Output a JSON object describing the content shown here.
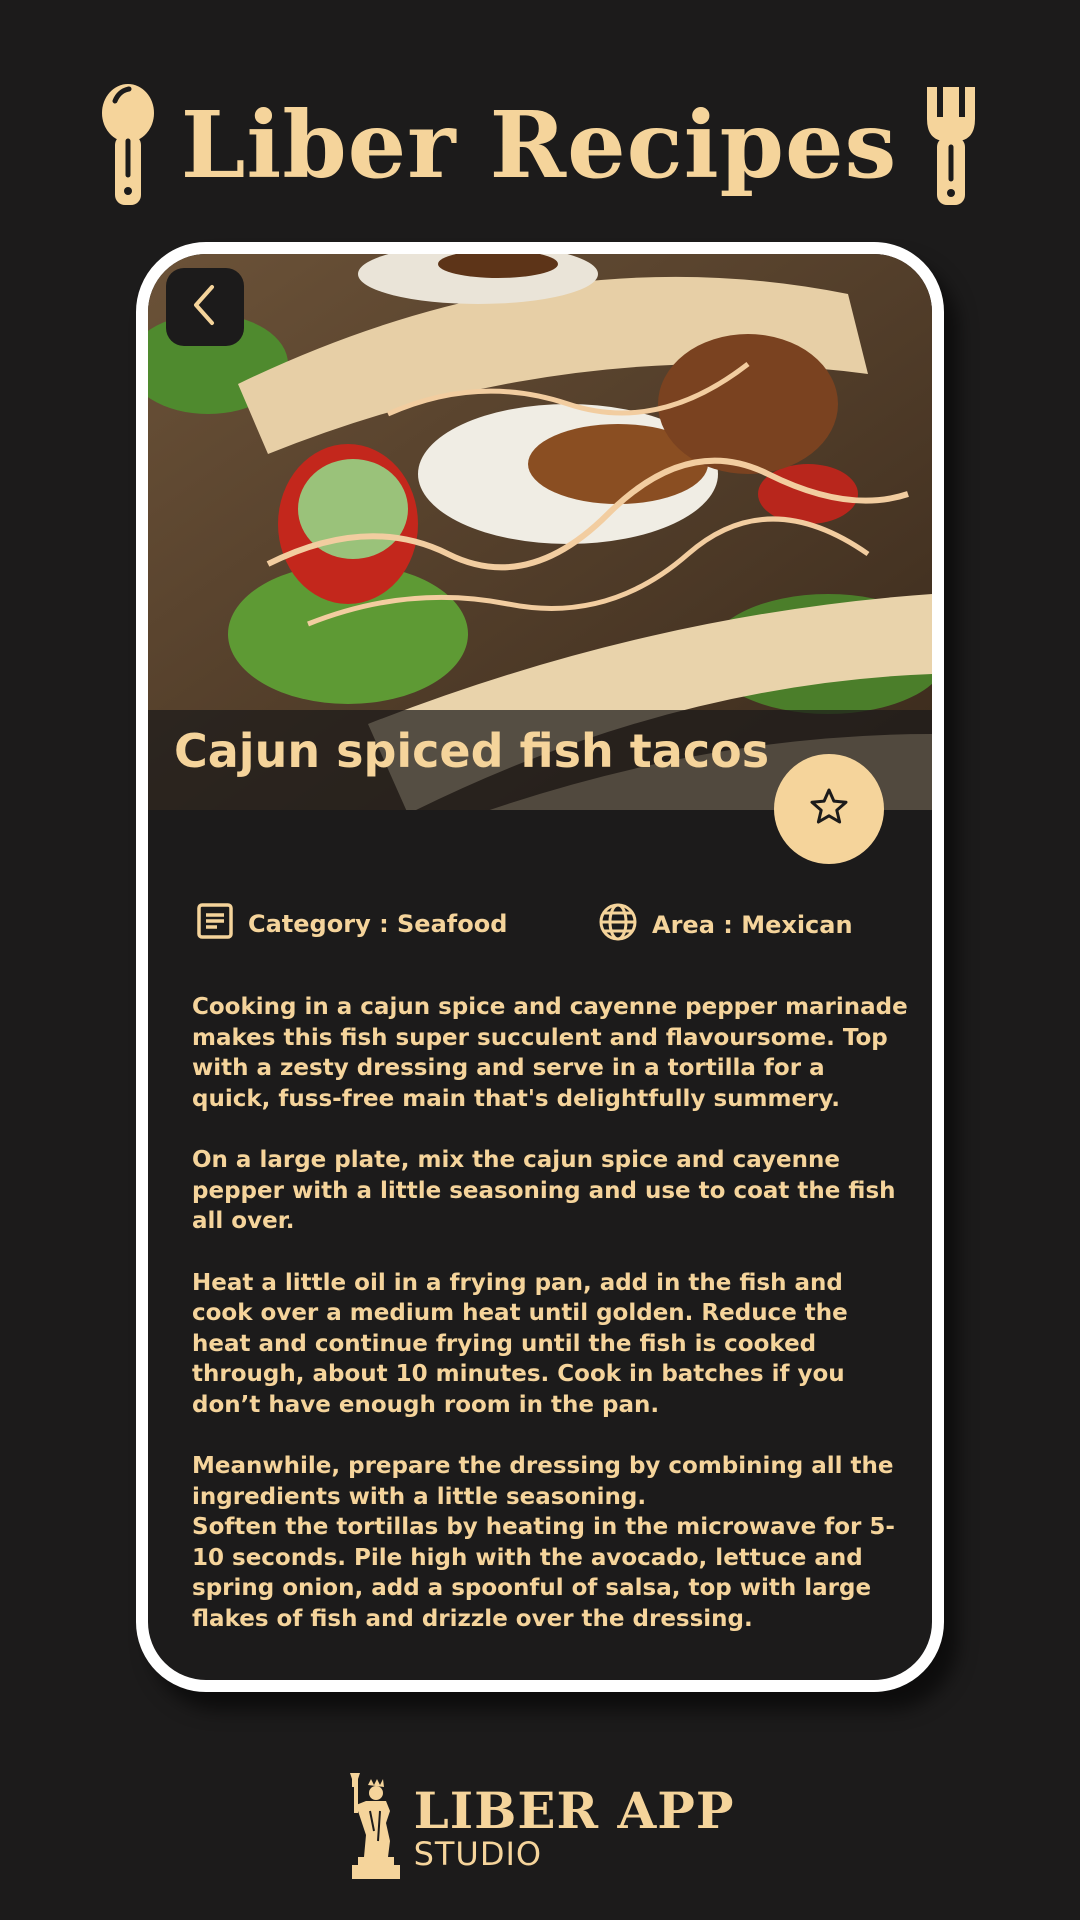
{
  "header": {
    "app_title": "Liber Recipes",
    "left_icon": "spoon-icon",
    "right_icon": "fork-icon"
  },
  "recipe": {
    "title": "Cajun spiced fish tacos",
    "image": "fish-tacos-photo",
    "category_icon": "category-icon",
    "category_text": "Category : Seafood",
    "area_icon": "globe-icon",
    "area_text": "Area : Mexican",
    "description": [
      "Cooking in a cajun spice and cayenne pepper marinade makes this fish super succulent and flavoursome. Top with a zesty dressing and serve in a tortilla for a quick, fuss-free main that's delightfully summery.",
      "On a large plate, mix the cajun spice and cayenne pepper with a little seasoning and use to coat the fish all over.",
      "Heat a little oil in a frying pan, add in the fish and cook over a medium heat until golden. Reduce the heat and continue frying until the fish is cooked through, about 10 minutes. Cook in batches if you don’t have enough room in the pan.",
      "Meanwhile, prepare the dressing by combining all the ingredients with a little seasoning.",
      "Soften the tortillas by heating in the microwave for 5-10 seconds. Pile high with the avocado, lettuce and spring onion, add a spoonful of salsa, top with large flakes of fish and drizzle over the dressing."
    ]
  },
  "controls": {
    "back_icon": "chevron-left-icon",
    "favorite_icon": "star-outline-icon"
  },
  "footer": {
    "brand_name": "LIBER APP",
    "brand_sub": "STUDIO",
    "logo_icon": "statue-of-liberty-icon"
  },
  "colors": {
    "background": "#1c1b1b",
    "accent": "#f5d49b",
    "frame": "#ffffff"
  }
}
